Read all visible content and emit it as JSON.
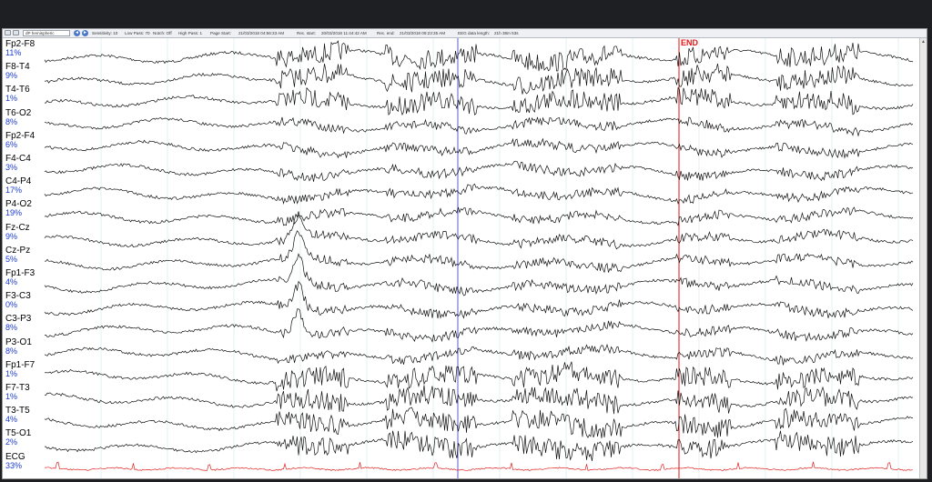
{
  "toolbar": {
    "montage": "dP hemispheric",
    "sensitivity": "Sensitivity: 10",
    "low_pass": "Low Pass: 70",
    "notch": "Notch: Off",
    "high_pass": "High Pass: 1",
    "page_start": "Page Start:",
    "page_start_value": "21/03/2018 04:56:33 AM",
    "rec_start": "Rec. start:",
    "rec_start_value": "20/03/2018 11:44:42 AM",
    "rec_end": "Rec. end:",
    "rec_end_value": "21/03/2018 09:23:35 AM",
    "data_length": "EEG data length:",
    "data_length_value": "21h 38m 53s"
  },
  "end_label": "END",
  "channels": [
    {
      "name": "Fp2-F8",
      "pct": "11%"
    },
    {
      "name": "F8-T4",
      "pct": "9%"
    },
    {
      "name": "T4-T6",
      "pct": "1%"
    },
    {
      "name": "T6-O2",
      "pct": "8%"
    },
    {
      "name": "Fp2-F4",
      "pct": "6%"
    },
    {
      "name": "F4-C4",
      "pct": "3%"
    },
    {
      "name": "C4-P4",
      "pct": "17%"
    },
    {
      "name": "P4-O2",
      "pct": "19%"
    },
    {
      "name": "Fz-Cz",
      "pct": "9%"
    },
    {
      "name": "Cz-Pz",
      "pct": "5%"
    },
    {
      "name": "Fp1-F3",
      "pct": "4%"
    },
    {
      "name": "F3-C3",
      "pct": "0%"
    },
    {
      "name": "C3-P3",
      "pct": "8%"
    },
    {
      "name": "P3-O1",
      "pct": "8%"
    },
    {
      "name": "Fp1-F7",
      "pct": "1%"
    },
    {
      "name": "F7-T3",
      "pct": "1%"
    },
    {
      "name": "T3-T5",
      "pct": "4%"
    },
    {
      "name": "T5-O1",
      "pct": "2%"
    },
    {
      "name": "ECG",
      "pct": "33%"
    }
  ],
  "colors": {
    "trace": "#111111",
    "ecg_trace": "#e02020",
    "grid": "#cfe6ee",
    "cursor": "#8a8ae6",
    "end_line": "#e21616",
    "pct_text": "#1a3ad6"
  }
}
